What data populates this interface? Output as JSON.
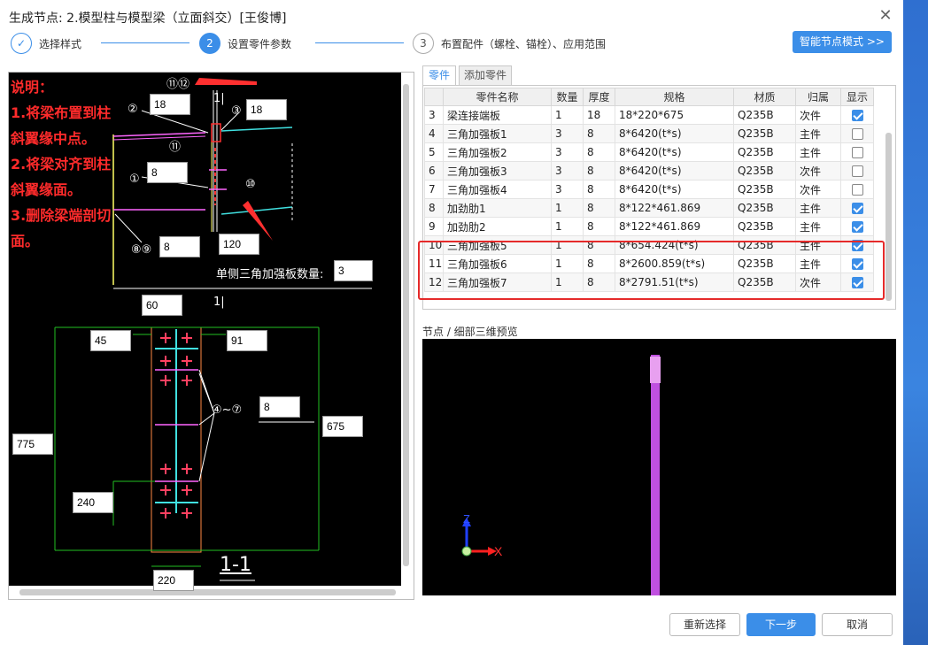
{
  "window": {
    "title": "生成节点: 2.模型柱与模型梁（立面斜交）[王俊博]"
  },
  "steps": [
    {
      "index": "✓",
      "label": "选择样式"
    },
    {
      "index": "2",
      "label": "设置零件参数"
    },
    {
      "index": "3",
      "label": "布置配件（螺栓、锚栓）、应用范围"
    }
  ],
  "smart_mode_label": "智能节点模式 >>",
  "drawing": {
    "notes": [
      "说明：",
      "1.将梁布置到柱",
      "斜翼缘中点。",
      "2.将梁对齐到柱",
      "斜翼缘面。",
      "3.删除梁端剖切",
      "面。"
    ],
    "inputs": {
      "top_left_thk": "18",
      "top_right_thk": "18",
      "stiff_thk": "8",
      "gusset_thk": "8",
      "len_120": "120",
      "tri_count": "3",
      "w60": "60",
      "w45": "45",
      "w91": "91",
      "plate8": "8",
      "h675": "675",
      "h775": "775",
      "h240": "240",
      "w220": "220"
    },
    "labels": {
      "tri_count_label": "单侧三角加强板数量:",
      "section": "1-1",
      "range": "④~⑦",
      "m11": "⑪⑫",
      "m2": "②",
      "m3": "③",
      "m11b": "⑪",
      "m1": "①",
      "m10": "⑩",
      "m89": "⑧⑨",
      "sec_mark_top": "1|",
      "sec_mark_bot": "1|"
    }
  },
  "tabs": {
    "parts": "零件",
    "add_part": "添加零件"
  },
  "table": {
    "headers": [
      "",
      "零件名称",
      "数量",
      "厚度",
      "规格",
      "材质",
      "归属",
      "显示"
    ],
    "rows": [
      {
        "no": "3",
        "name": "梁连接端板",
        "qty": "1",
        "thk": "18",
        "spec": "18*220*675",
        "mat": "Q235B",
        "owner": "次件",
        "show": true
      },
      {
        "no": "4",
        "name": "三角加强板1",
        "qty": "3",
        "thk": "8",
        "spec": "8*6420(t*s)",
        "mat": "Q235B",
        "owner": "主件",
        "show": false
      },
      {
        "no": "5",
        "name": "三角加强板2",
        "qty": "3",
        "thk": "8",
        "spec": "8*6420(t*s)",
        "mat": "Q235B",
        "owner": "主件",
        "show": false
      },
      {
        "no": "6",
        "name": "三角加强板3",
        "qty": "3",
        "thk": "8",
        "spec": "8*6420(t*s)",
        "mat": "Q235B",
        "owner": "次件",
        "show": false
      },
      {
        "no": "7",
        "name": "三角加强板4",
        "qty": "3",
        "thk": "8",
        "spec": "8*6420(t*s)",
        "mat": "Q235B",
        "owner": "次件",
        "show": false
      },
      {
        "no": "8",
        "name": "加劲肋1",
        "qty": "1",
        "thk": "8",
        "spec": "8*122*461.869",
        "mat": "Q235B",
        "owner": "主件",
        "show": true
      },
      {
        "no": "9",
        "name": "加劲肋2",
        "qty": "1",
        "thk": "8",
        "spec": "8*122*461.869",
        "mat": "Q235B",
        "owner": "主件",
        "show": true
      },
      {
        "no": "10",
        "name": "三角加强板5",
        "qty": "1",
        "thk": "8",
        "spec": "8*654.424(t*s)",
        "mat": "Q235B",
        "owner": "主件",
        "show": true
      },
      {
        "no": "11",
        "name": "三角加强板6",
        "qty": "1",
        "thk": "8",
        "spec": "8*2600.859(t*s)",
        "mat": "Q235B",
        "owner": "主件",
        "show": true
      },
      {
        "no": "12",
        "name": "三角加强板7",
        "qty": "1",
        "thk": "8",
        "spec": "8*2791.51(t*s)",
        "mat": "Q235B",
        "owner": "次件",
        "show": true
      }
    ]
  },
  "preview": {
    "label": "节点 / 细部三维预览",
    "axis_z": "Z",
    "axis_x": "X"
  },
  "buttons": {
    "reselect": "重新选择",
    "next": "下一步",
    "cancel": "取消"
  },
  "colors": {
    "accent": "#3b8ee8",
    "highlight_box": "#e52a2a",
    "note_text": "#ff2b2b",
    "member": "#c050e0"
  }
}
